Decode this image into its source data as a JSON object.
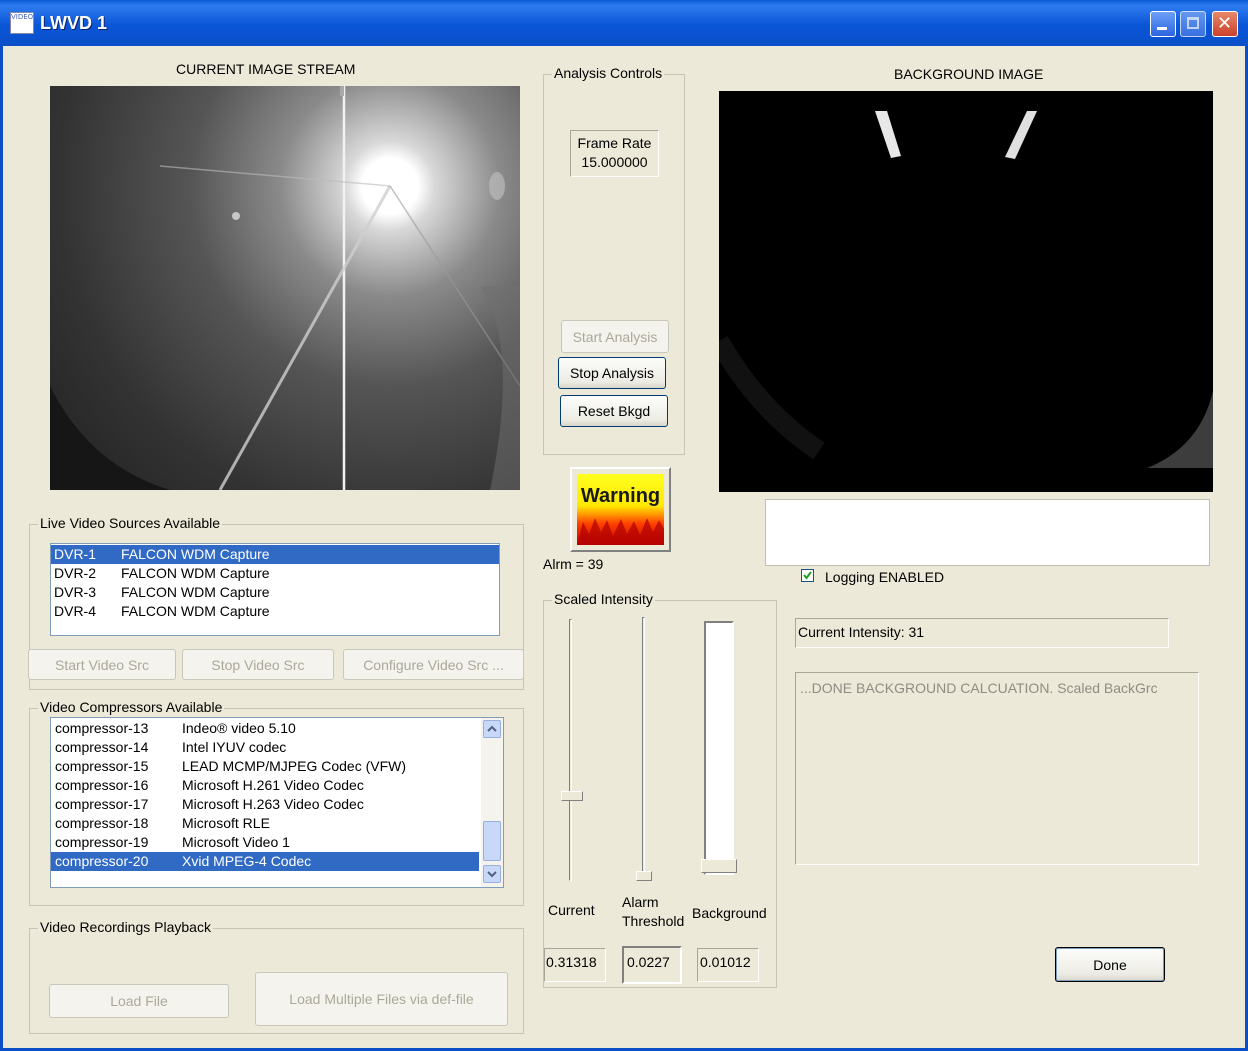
{
  "window": {
    "title": "LWVD 1",
    "icon_text": "VIDEO"
  },
  "current_stream": {
    "label": "CURRENT IMAGE STREAM"
  },
  "background": {
    "label": "BACKGROUND IMAGE"
  },
  "analysis": {
    "title": "Analysis Controls",
    "frame_rate_label": "Frame Rate",
    "frame_rate_value": "15.000000",
    "start_label": "Start Analysis",
    "stop_label": "Stop Analysis",
    "reset_label": "Reset Bkgd"
  },
  "warning": {
    "text": "Warning",
    "alarm_text": "Alrm = 39"
  },
  "live_sources": {
    "title": "Live Video Sources Available",
    "items": [
      {
        "id": "DVR-1",
        "name": "FALCON WDM Capture"
      },
      {
        "id": "DVR-2",
        "name": "FALCON WDM Capture"
      },
      {
        "id": "DVR-3",
        "name": "FALCON WDM Capture"
      },
      {
        "id": "DVR-4",
        "name": "FALCON WDM Capture"
      }
    ],
    "selected_index": 0,
    "start_label": "Start Video Src",
    "stop_label": "Stop Video Src",
    "configure_label": "Configure Video Src ..."
  },
  "compressors": {
    "title": "Video Compressors Available",
    "items": [
      {
        "id": "compressor-13",
        "name": "Indeo® video 5.10"
      },
      {
        "id": "compressor-14",
        "name": "Intel IYUV codec"
      },
      {
        "id": "compressor-15",
        "name": "LEAD MCMP/MJPEG Codec (VFW)"
      },
      {
        "id": "compressor-16",
        "name": "Microsoft H.261 Video Codec"
      },
      {
        "id": "compressor-17",
        "name": "Microsoft H.263 Video Codec"
      },
      {
        "id": "compressor-18",
        "name": "Microsoft RLE"
      },
      {
        "id": "compressor-19",
        "name": "Microsoft Video 1"
      },
      {
        "id": "compressor-20",
        "name": "Xvid MPEG-4 Codec"
      }
    ],
    "selected_index": 7
  },
  "playback": {
    "title": "Video Recordings Playback",
    "load_label": "Load File",
    "load_multi_label": "Load Multiple Files via def-file"
  },
  "scaled_intensity": {
    "title": "Scaled Intensity",
    "current_label": "Current",
    "alarm_label_line1": "Alarm",
    "alarm_label_line2": "Threshold",
    "background_label": "Background",
    "current_value": "0.31318",
    "alarm_value": "0.0227",
    "background_value": "0.01012",
    "current_level": 0.31,
    "alarm_level": 0.02,
    "background_level": 0.01
  },
  "logging": {
    "label": "Logging ENABLED",
    "checked": true
  },
  "status": {
    "intensity_text": "Current Intensity: 31",
    "log_text": "...DONE BACKGROUND CALCUATION.  Scaled BackGrc"
  },
  "done_label": "Done",
  "colors": {
    "titlebar": "#0A56D8",
    "selection": "#316AC5",
    "dialog_bg": "#ECE9D8"
  }
}
